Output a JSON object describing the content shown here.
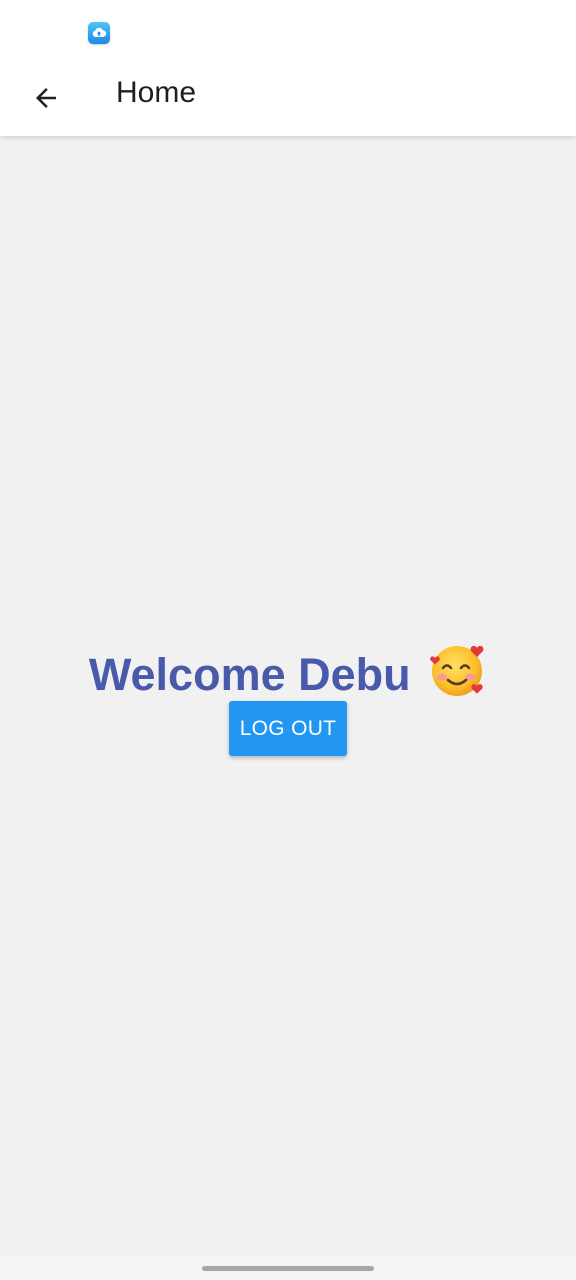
{
  "status_bar": {
    "notification_icon": "cloud-upload-icon"
  },
  "app_bar": {
    "back_icon": "arrow-back-icon",
    "title": "Home"
  },
  "main": {
    "welcome_text": "Welcome Debu",
    "welcome_emoji_icon": "smiling-face-with-hearts-icon",
    "logout_label": "LOG OUT"
  },
  "colors": {
    "welcome_text": "#4a5aab",
    "logout_button": "#2196f3",
    "background": "#f1f1f1"
  }
}
